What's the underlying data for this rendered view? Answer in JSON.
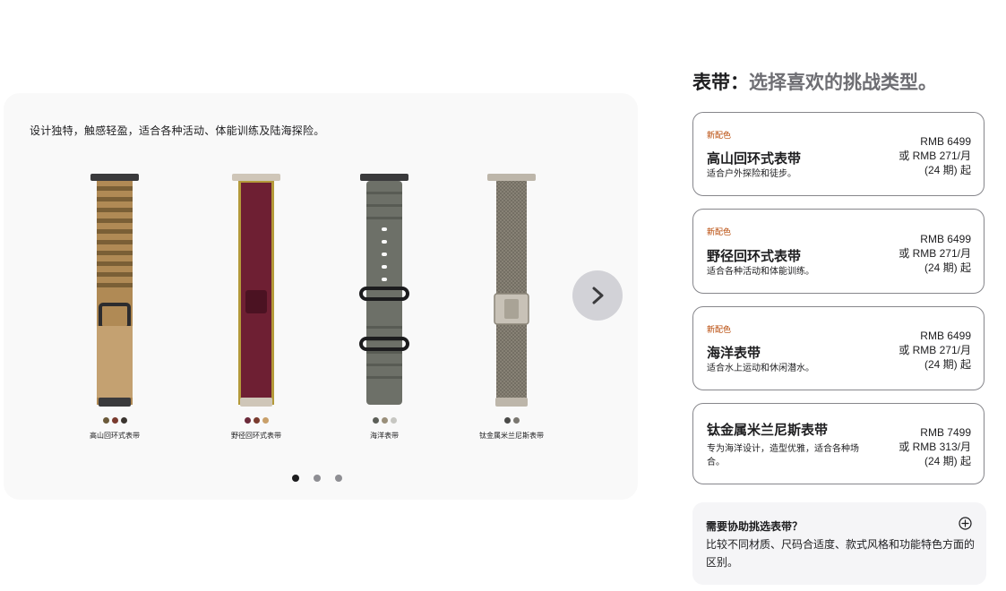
{
  "gallery": {
    "caption": "设计独特，触感轻盈，适合各种活动、体能训练及陆海探险。",
    "bands": [
      {
        "name": "高山回环式表带",
        "swatches": [
          "#6b5a3a",
          "#7a3b2e",
          "#3b3530"
        ]
      },
      {
        "name": "野径回环式表带",
        "swatches": [
          "#6b2a3a",
          "#7a3b2e",
          "#c9a06a"
        ]
      },
      {
        "name": "海洋表带",
        "swatches": [
          "#5c5f58",
          "#9a8f7a",
          "#c7c7c2"
        ]
      },
      {
        "name": "钛金属米兰尼斯表带",
        "swatches": [
          "#4a4a48",
          "#7a7770"
        ]
      }
    ],
    "next_icon": "chevron-right-icon",
    "pagination": [
      "1",
      "2",
      "3"
    ],
    "active_page": 0
  },
  "panel": {
    "title_lead": "表带：",
    "title_rest": "选择喜欢的挑战类型。",
    "options": [
      {
        "badge": "新配色",
        "name": "高山回环式表带",
        "desc": "适合户外探险和徒步。",
        "price": "RMB 6499",
        "monthly": "或 RMB 271/月",
        "term": "(24 期) 起"
      },
      {
        "badge": "新配色",
        "name": "野径回环式表带",
        "desc": "适合各种活动和体能训练。",
        "price": "RMB 6499",
        "monthly": "或 RMB 271/月",
        "term": "(24 期) 起"
      },
      {
        "badge": "新配色",
        "name": "海洋表带",
        "desc": "适合水上运动和休闲潜水。",
        "price": "RMB 6499",
        "monthly": "或 RMB 271/月",
        "term": "(24 期) 起"
      },
      {
        "badge": "",
        "name": "钛金属米兰尼斯表带",
        "desc": "专为海洋设计，造型优雅，适合各种场合。",
        "price": "RMB 7499",
        "monthly": "或 RMB 313/月",
        "term": "(24 期) 起"
      }
    ],
    "help": {
      "title": "需要协助挑选表带？",
      "text": "比较不同材质、尺码合适度、款式风格和功能特色方面的区别。",
      "icon": "plus-circle-icon"
    }
  },
  "colors": {
    "accent_new": "#b64400",
    "border": "#86868b"
  }
}
